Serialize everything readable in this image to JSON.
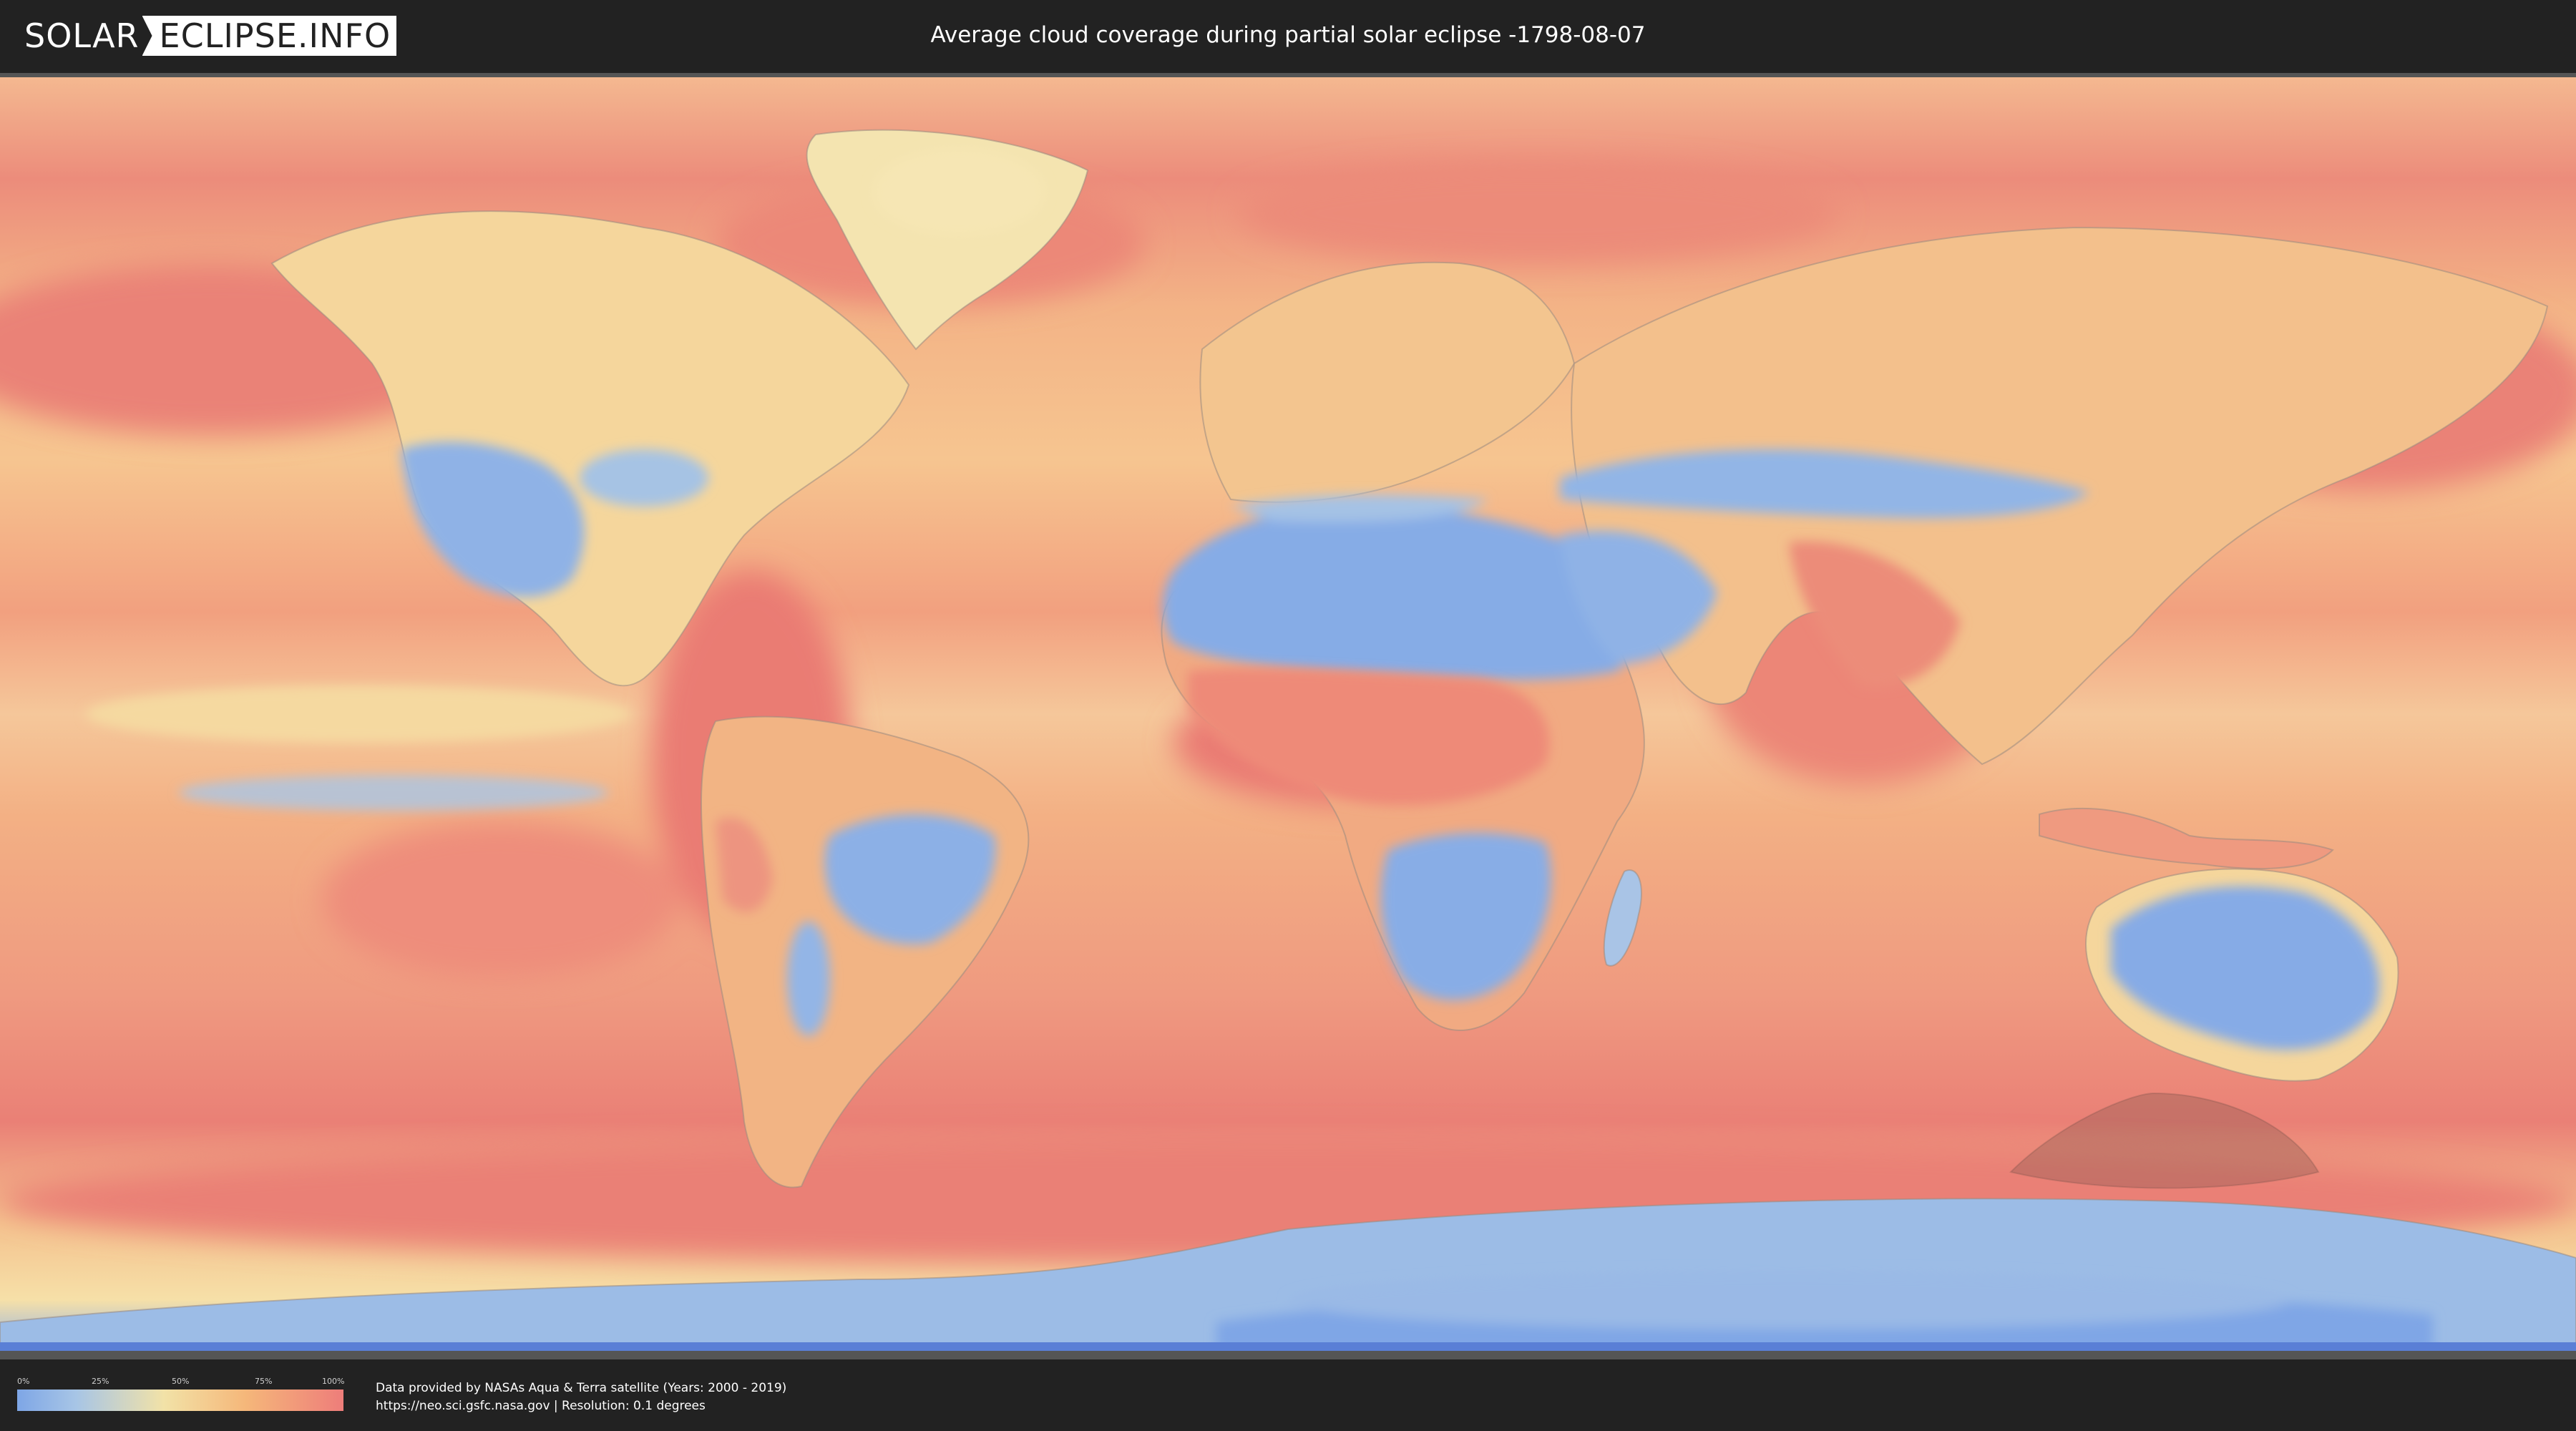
{
  "header": {
    "logo_left": "SOLAR",
    "logo_right": "ECLIPSE.INFO",
    "title": "Average cloud coverage during partial solar eclipse -1798-08-07"
  },
  "legend": {
    "ticks": [
      "0%",
      "25%",
      "50%",
      "75%",
      "100%"
    ],
    "colors": [
      "#7ea6e6",
      "#a7c5e6",
      "#f2e2a7",
      "#f5b77a",
      "#ee7d7a"
    ]
  },
  "footer": {
    "credit_line1": "Data provided by NASAs Aqua & Terra satellite (Years: 2000 - 2019)",
    "credit_line2": "https://neo.sci.gsfc.nasa.gov | Resolution: 0.1 degrees"
  },
  "map": {
    "ocean_color": "#f0a877",
    "cloudy_color": "#ea8277",
    "clear_color": "#8ab0e6",
    "mid_color": "#f5dfa1",
    "eclipse_shadow_color": "#7a5a55"
  }
}
